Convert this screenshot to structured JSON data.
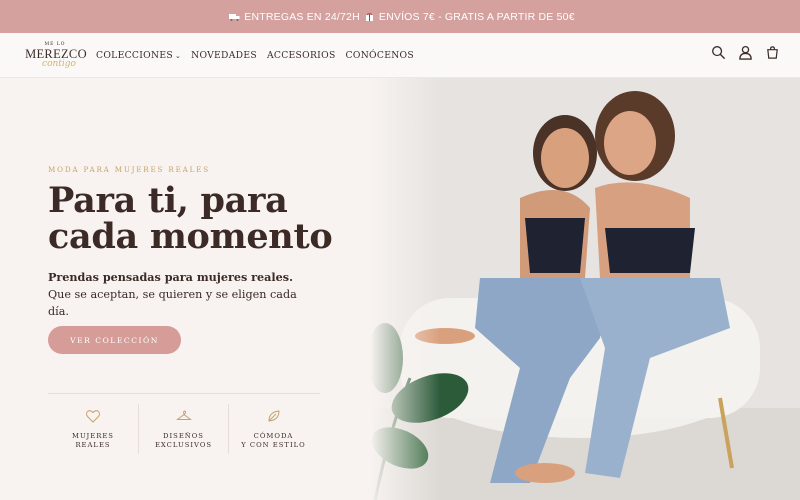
{
  "announcement": {
    "text_1": "ENTREGAS EN 24/72H",
    "text_2": "ENVÍOS 7€ - GRATIS A PARTIR DE 50€",
    "icon_1": "truck-icon",
    "icon_2": "gift-icon"
  },
  "header": {
    "logo": {
      "top": "ME LO",
      "main": "MEREZCO",
      "script": "contigo"
    },
    "nav": [
      {
        "label": "COLECCIONES",
        "has_dropdown": true
      },
      {
        "label": "NOVEDADES"
      },
      {
        "label": "ACCESORIOS"
      },
      {
        "label": "CONÓCENOS"
      }
    ],
    "icons": [
      "search-icon",
      "account-icon",
      "cart-icon"
    ]
  },
  "hero": {
    "eyebrow": "MODA PARA MUJERES REALES",
    "title_line_1": "Para ti, para",
    "title_line_2": "cada momento",
    "subtitle_bold": "Prendas pensadas para mujeres reales.",
    "subtitle_rest": "Que se aceptan, se quieren y se eligen cada día.",
    "cta_label": "VER COLECCIÓN",
    "image_alt": "Dos mujeres sonrientes sentadas juntas en un sillón blanco"
  },
  "features": [
    {
      "icon": "heart-icon",
      "line_1": "MUJERES",
      "line_2": "REALES"
    },
    {
      "icon": "hanger-icon",
      "line_1": "DISEÑOS",
      "line_2": "EXCLUSIVOS"
    },
    {
      "icon": "leaf-icon",
      "line_1": "CÓMODA",
      "line_2": "Y CON ESTILO"
    }
  ],
  "colors": {
    "announcement_bg": "#d4a19f",
    "cta_bg": "#d69c97",
    "eyebrow": "#c7a36a",
    "page_bg": "#f8f3f0",
    "text": "#3b2a26"
  }
}
